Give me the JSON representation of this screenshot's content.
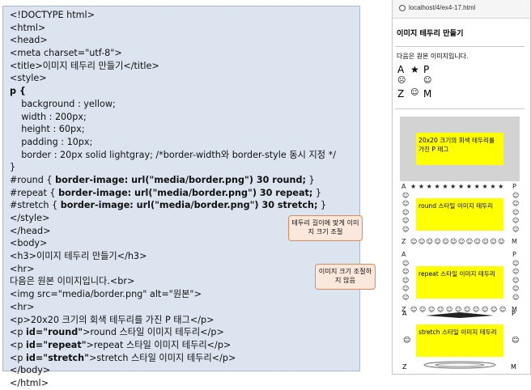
{
  "code_lines": [
    {
      "segs": [
        {
          "t": "<!DOCTYPE html>",
          "b": false
        }
      ]
    },
    {
      "segs": [
        {
          "t": "<html>",
          "b": false
        }
      ]
    },
    {
      "segs": [
        {
          "t": "<head>",
          "b": false
        }
      ]
    },
    {
      "segs": [
        {
          "t": "<meta charset=\"utf-8\">",
          "b": false
        }
      ]
    },
    {
      "segs": [
        {
          "t": "<title>이미지 테두리 만들기</title>",
          "b": false
        }
      ]
    },
    {
      "segs": [
        {
          "t": "<style>",
          "b": false
        }
      ]
    },
    {
      "segs": [
        {
          "t": "p {",
          "b": true
        }
      ]
    },
    {
      "segs": [
        {
          "t": "    background : yellow;",
          "b": false
        }
      ]
    },
    {
      "segs": [
        {
          "t": "    width : 200px;",
          "b": false
        }
      ]
    },
    {
      "segs": [
        {
          "t": "    height : 60px;",
          "b": false
        }
      ]
    },
    {
      "segs": [
        {
          "t": "    padding : 10px;",
          "b": false
        }
      ]
    },
    {
      "segs": [
        {
          "t": "    border : 20px solid lightgray; /*border-width와 border-style 동시 지정 */",
          "b": false
        }
      ]
    },
    {
      "segs": [
        {
          "t": "}",
          "b": false
        }
      ]
    },
    {
      "segs": [
        {
          "t": "#round { ",
          "b": false
        },
        {
          "t": "border-image: url(\"media/border.png\") 30 round;",
          "b": true
        },
        {
          "t": " }",
          "b": false
        }
      ]
    },
    {
      "segs": [
        {
          "t": "#repeat { ",
          "b": false
        },
        {
          "t": "border-image: url(\"media/border.png\") 30 repeat;",
          "b": true
        },
        {
          "t": " }",
          "b": false
        }
      ]
    },
    {
      "segs": [
        {
          "t": "#stretch { ",
          "b": false
        },
        {
          "t": "border-image: url(\"media/border.png\") 30 stretch;",
          "b": true
        },
        {
          "t": " }",
          "b": false
        }
      ]
    },
    {
      "segs": [
        {
          "t": "</style>",
          "b": false
        }
      ]
    },
    {
      "segs": [
        {
          "t": "</head>",
          "b": false
        }
      ]
    },
    {
      "segs": [
        {
          "t": "<body>",
          "b": false
        }
      ]
    },
    {
      "segs": [
        {
          "t": "<h3>이미지 테두리 만들기</h3>",
          "b": false
        }
      ]
    },
    {
      "segs": [
        {
          "t": "<hr>",
          "b": false
        }
      ]
    },
    {
      "segs": [
        {
          "t": "다음은 원본 이미지입니다.<br>",
          "b": false
        }
      ]
    },
    {
      "segs": [
        {
          "t": "<img src=\"media/border.png\" alt=\"원본\">",
          "b": false
        }
      ]
    },
    {
      "segs": [
        {
          "t": "<hr>",
          "b": false
        }
      ]
    },
    {
      "segs": [
        {
          "t": "<p>20x20 크기의 회색 테두리를 가진 P 태그</p>",
          "b": false
        }
      ]
    },
    {
      "segs": [
        {
          "t": "<p ",
          "b": false
        },
        {
          "t": "id=\"round\"",
          "b": true
        },
        {
          "t": ">round 스타일 이미지 테두리</p>",
          "b": false
        }
      ]
    },
    {
      "segs": [
        {
          "t": "<p ",
          "b": false
        },
        {
          "t": "id=\"repeat\"",
          "b": true
        },
        {
          "t": ">repeat 스타일 이미지 테두리</p>",
          "b": false
        }
      ]
    },
    {
      "segs": [
        {
          "t": "<p ",
          "b": false
        },
        {
          "t": "id=\"stretch\"",
          "b": true
        },
        {
          "t": ">stretch 스타일 이미지 테두리</p>",
          "b": false
        }
      ]
    },
    {
      "segs": [
        {
          "t": "</body>",
          "b": false
        }
      ]
    },
    {
      "segs": [
        {
          "t": "</html>",
          "b": false
        }
      ]
    }
  ],
  "browser": {
    "url": "localhost/4/ex4-17.html",
    "heading": "이미지 테두리 만들기",
    "original_text": "다음은 원본 이미지입니다.",
    "orig_glyphs": [
      "A",
      "★",
      "P",
      "☹",
      "☺",
      "Z",
      "☺",
      "M"
    ],
    "p_gray": "20x20 크기의 회색 테두리를 가진 P 태그",
    "p_round": "round 스타일 이미지 테두리",
    "p_repeat": "repeat 스타일 이미지 테두리",
    "p_stretch": "stretch 스타일 이미지 테두리",
    "border_glyphs": {
      "corner_a": "A",
      "corner_p": "P",
      "corner_z": "Z",
      "corner_m": "M",
      "star": "★",
      "face": "☺"
    }
  },
  "callouts": {
    "round": "테두리 길이에 맞게 이미지 크기 조절",
    "stretch": "이미지 크기 조절하지 않음"
  },
  "colors": {
    "yellow": "#ffff00",
    "lightgray": "#d3d3d3",
    "code_bg": "#dbe4ef",
    "callout_bg": "#fbe8dd",
    "callout_border": "#e08a5a"
  }
}
